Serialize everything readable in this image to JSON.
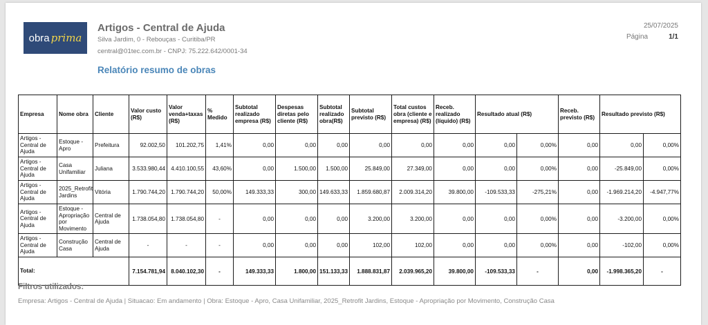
{
  "header": {
    "logo": {
      "part1": "obra",
      "part2": "prima"
    },
    "company_name": "Artigos - Central de Ajuda",
    "address": "Silva Jardim, 0 - Rebouças - Curitiba/PR",
    "contact": "central@01tec.com.br - CNPJ: 75.222.642/0001-34",
    "date": "25/07/2025",
    "page_label": "Página",
    "page_value": "1/1",
    "report_title": "Relatório resumo de obras"
  },
  "table": {
    "headers": {
      "empresa": "Empresa",
      "nome_obra": "Nome obra",
      "cliente": "Cliente",
      "valor_custo": "Valor custo (R$)",
      "valor_venda": "Valor venda+taxas (R$)",
      "medido": "% Medido",
      "subtotal_empresa": "Subtotal realizado empresa (R$)",
      "despesas": "Despesas diretas pelo cliente (R$)",
      "subtotal_obra": "Subtotal realizado obra(R$)",
      "subtotal_previsto": "Subtotal previsto (R$)",
      "total_custos": "Total custos obra (cliente e empresa) (R$)",
      "receb_realizado": "Receb. realizado (líquido) (R$)",
      "resultado_atual": "Resultado atual (R$)",
      "receb_previsto": "Receb. previsto (R$)",
      "resultado_previsto": "Resultado previsto (R$)"
    },
    "rows": [
      [
        "Artigos - Central de Ajuda",
        "Estoque - Apro",
        "Prefeitura",
        "92.002,50",
        "101.202,75",
        "1,41%",
        "0,00",
        "0,00",
        "0,00",
        "0,00",
        "0,00",
        "0,00",
        "0,00",
        "0,00%",
        "0,00",
        "0,00",
        "0,00%"
      ],
      [
        "Artigos - Central de Ajuda",
        "Casa Unifamiliar",
        "Juliana",
        "3.533.980,44",
        "4.410.100,55",
        "43,60%",
        "0,00",
        "1.500,00",
        "1.500,00",
        "25.849,00",
        "27.349,00",
        "0,00",
        "0,00",
        "0,00%",
        "0,00",
        "-25.849,00",
        "0,00%"
      ],
      [
        "Artigos - Central de Ajuda",
        "2025_Retrofit Jardins",
        "Vitória",
        "1.790.744,20",
        "1.790.744,20",
        "50,00%",
        "149.333,33",
        "300,00",
        "149.633,33",
        "1.859.680,87",
        "2.009.314,20",
        "39.800,00",
        "-109.533,33",
        "-275,21%",
        "0,00",
        "-1.969.214,20",
        "-4.947,77%"
      ],
      [
        "Artigos - Central de Ajuda",
        "Estoque - Apropriação por Movimento",
        "Central de Ajuda",
        "1.738.054,80",
        "1.738.054,80",
        "-",
        "0,00",
        "0,00",
        "0,00",
        "3.200,00",
        "3.200,00",
        "0,00",
        "0,00",
        "0,00%",
        "0,00",
        "-3.200,00",
        "0,00%"
      ],
      [
        "Artigos - Central de Ajuda",
        "Construção Casa",
        "Central de Ajuda",
        "-",
        "-",
        "-",
        "0,00",
        "0,00",
        "0,00",
        "102,00",
        "102,00",
        "0,00",
        "0,00",
        "0,00%",
        "0,00",
        "-102,00",
        "0,00%"
      ]
    ],
    "total": {
      "label": "Total:",
      "values": [
        "7.154.781,94",
        "8.040.102,30",
        "-",
        "149.333,33",
        "1.800,00",
        "151.133,33",
        "1.888.831,87",
        "2.039.965,20",
        "39.800,00",
        "-109.533,33",
        "-",
        "0,00",
        "-1.998.365,20",
        "-"
      ]
    }
  },
  "filters": {
    "title": "Filtros utilizados:",
    "text": "Empresa: Artigos - Central de Ajuda | Situacao: Em andamento | Obra: Estoque - Apro, Casa Unifamiliar, 2025_Retrofit Jardins, Estoque - Apropriação por Movimento, Construção Casa"
  }
}
